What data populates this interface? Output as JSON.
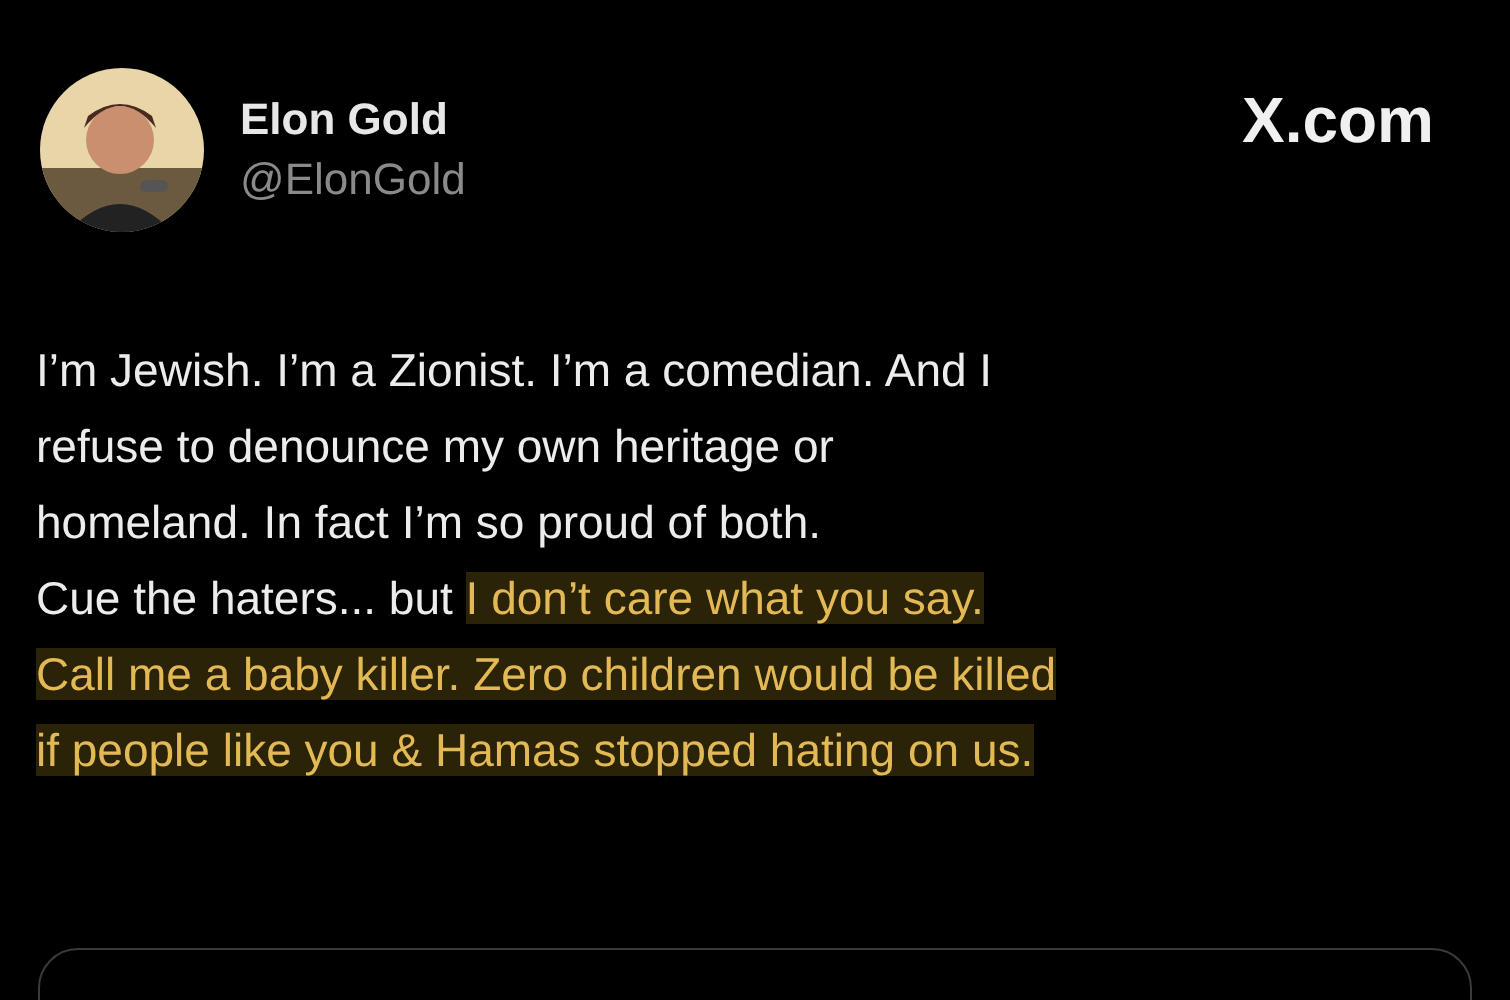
{
  "author": {
    "name": "Elon Gold",
    "handle": "@ElonGold"
  },
  "site_label": "X.com",
  "post": {
    "lines": [
      [
        {
          "text": "I’m Jewish. I’m a Zionist. I’m a comedian. And I",
          "highlighted": false
        }
      ],
      [
        {
          "text": "refuse to denounce my own heritage or",
          "highlighted": false
        }
      ],
      [
        {
          "text": "homeland. In fact I’m so proud of both.",
          "highlighted": false
        }
      ],
      [
        {
          "text": "Cue the haters... but ",
          "highlighted": false
        },
        {
          "text": "I don’t care what you say.",
          "highlighted": true
        }
      ],
      [
        {
          "text": "Call me a baby killer. Zero children would be killed",
          "highlighted": true
        }
      ],
      [
        {
          "text": "if people like you & Hamas stopped hating on us.",
          "highlighted": true
        }
      ]
    ]
  }
}
